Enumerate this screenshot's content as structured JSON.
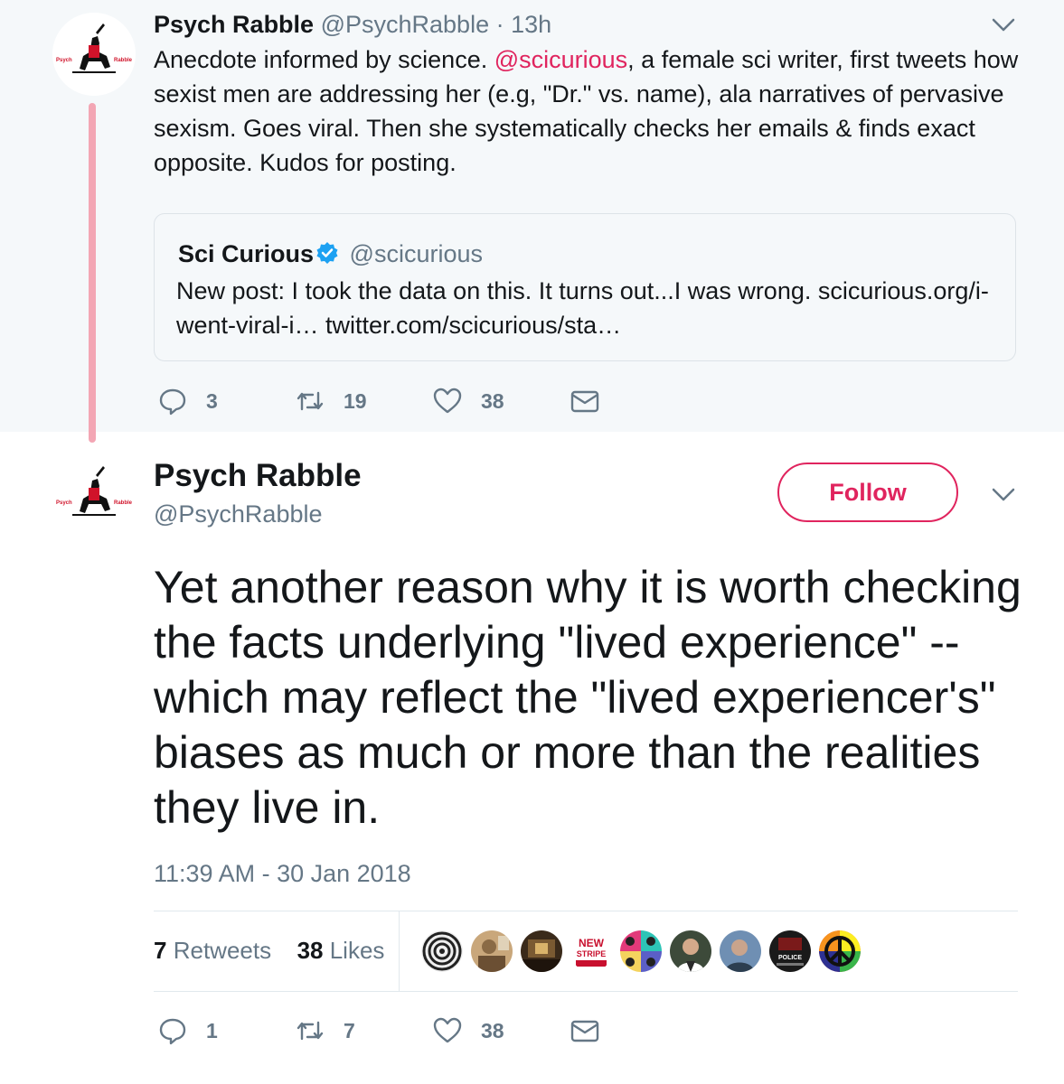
{
  "parent_tweet": {
    "display_name": "Psych Rabble",
    "handle": "@PsychRabble",
    "separator": "·",
    "time": "13h",
    "text_before_mention": "Anecdote informed by science. ",
    "mention": "@scicurious",
    "text_after_mention": ", a female sci writer, first tweets how sexist men are addressing her (e.g, \"Dr.\" vs. name), ala narratives of pervasive sexism. Goes viral. Then she systematically checks her emails & finds exact opposite. Kudos for posting.",
    "quote": {
      "display_name": "Sci Curious",
      "handle": "@scicurious",
      "text": "New post: I took the data on this. It turns out...I was wrong. scicurious.org/i-went-viral-i… twitter.com/scicurious/sta…"
    },
    "actions": {
      "replies": "3",
      "retweets": "19",
      "likes": "38"
    }
  },
  "main_tweet": {
    "display_name": "Psych Rabble",
    "handle": "@PsychRabble",
    "follow_label": "Follow",
    "text": "Yet another reason why it is worth checking the facts underlying \"lived experience\" -- which may reflect the \"lived experiencer's\" biases as much or more than the realities they live in.",
    "timestamp": "11:39 AM - 30 Jan 2018",
    "stats": {
      "retweets_count": "7",
      "retweets_label": "Retweets",
      "likes_count": "38",
      "likes_label": "Likes"
    },
    "liker_avatar_icons": [
      "spiral-avatar-icon",
      "photo-avatar-icon",
      "photo-avatar-icon",
      "new-stripe-avatar-icon",
      "popart-avatar-icon",
      "photo-avatar-icon",
      "photo-avatar-icon",
      "police-avatar-icon",
      "peace-sign-avatar-icon"
    ],
    "liker_text": {
      "new_stripe": "NEW STRIPE",
      "police": "POLICE"
    },
    "actions": {
      "replies": "1",
      "retweets": "7",
      "likes": "38"
    }
  },
  "logo_text": {
    "left": "Psych",
    "right": "Rabble"
  },
  "colors": {
    "accent": "#e0245e",
    "muted": "#657786",
    "thread_line": "#f3a6b4",
    "verified": "#1da1f2"
  }
}
